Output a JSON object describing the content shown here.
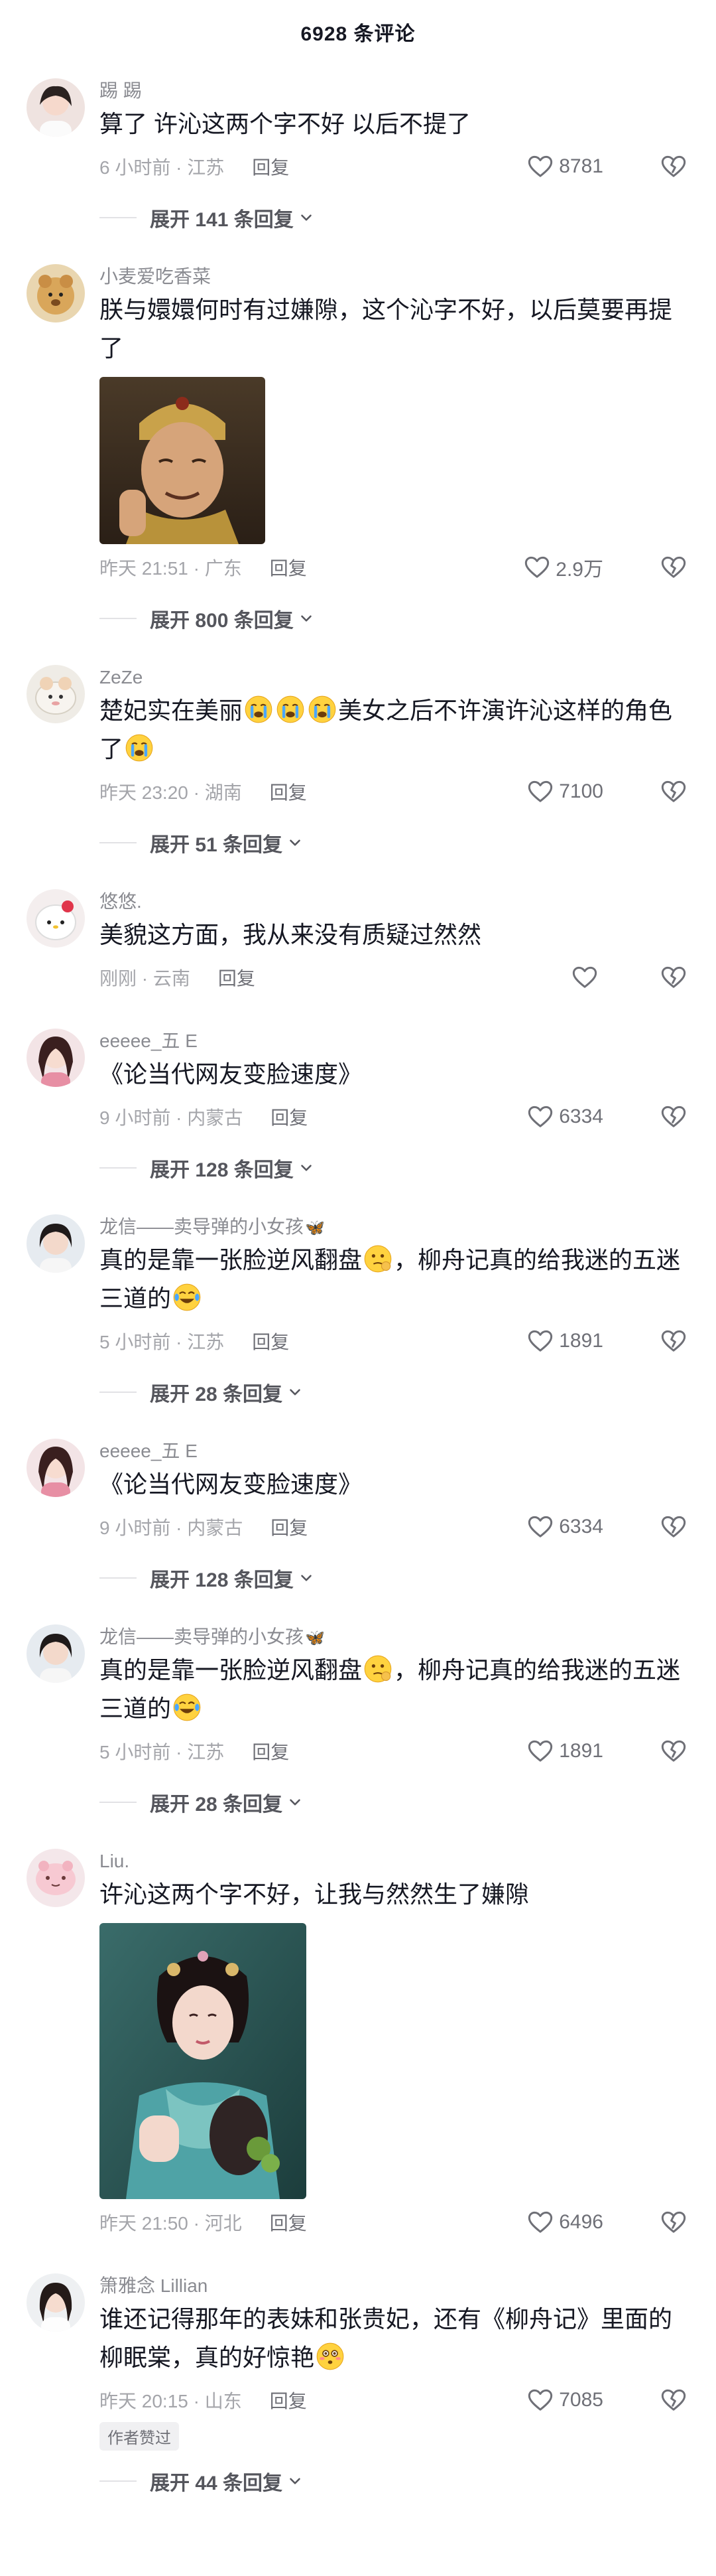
{
  "header": {
    "title": "6928 条评论"
  },
  "colors": {
    "text": "#161823",
    "meta": "#a4a5aa",
    "icon": "#6f7077",
    "accent_green": "#6fc06c"
  },
  "comments": [
    {
      "username": "踢 踢",
      "text": "算了 许沁这两个字不好 以后不提了",
      "time_loc": "6 小时前 · 江苏",
      "reply": "回复",
      "likes": "8781",
      "expand": "展开 141 条回复"
    },
    {
      "username": "小麦爱吃香菜",
      "text": "朕与嬛嬛何时有过嫌隙，这个沁字不好，以后莫要再提了",
      "time_loc": "昨天 21:51 · 广东",
      "reply": "回复",
      "likes": "2.9万",
      "expand": "展开 800 条回复",
      "image_icon": "emperor-portrait"
    },
    {
      "username": "ZeZe",
      "text_a": "楚妃实在美丽",
      "text_b": "美女之后不许演许沁这样的角色了",
      "emoji": "crying-emoji",
      "time_loc": "昨天 23:20 · 湖南",
      "reply": "回复",
      "likes": "7100",
      "expand": "展开 51 条回复"
    },
    {
      "username": "悠悠.",
      "text": "美貌这方面，我从来没有质疑过然然",
      "time_loc": "刚刚 · 云南",
      "reply": "回复",
      "likes": ""
    },
    {
      "username": "eeeee_五 E",
      "text": "《论当代网友变脸速度》",
      "time_loc": "9 小时前 · 内蒙古",
      "reply": "回复",
      "likes": "6334",
      "expand": "展开 128 条回复"
    },
    {
      "username": "龙信——卖导弹的小女孩",
      "text_a": "真的是靠一张脸逆风翻盘",
      "text_b": "，柳舟记真的给我迷的五迷三道的",
      "emoji_a": "thinking-emoji",
      "emoji_b": "laughing-emoji",
      "time_loc": "5 小时前 · 江苏",
      "reply": "回复",
      "likes": "1891",
      "expand": "展开 28 条回复"
    },
    {
      "username": "eeeee_五 E",
      "text": "《论当代网友变脸速度》",
      "time_loc": "9 小时前 · 内蒙古",
      "reply": "回复",
      "likes": "6334",
      "expand": "展开 128 条回复"
    },
    {
      "username": "龙信——卖导弹的小女孩",
      "text_a": "真的是靠一张脸逆风翻盘",
      "text_b": "，柳舟记真的给我迷的五迷三道的",
      "emoji_a": "thinking-emoji",
      "emoji_b": "laughing-emoji",
      "time_loc": "5 小时前 · 江苏",
      "reply": "回复",
      "likes": "1891",
      "expand": "展开 28 条回复"
    },
    {
      "username": "Liu.",
      "text": "许沁这两个字不好，让我与然然生了嫌隙",
      "time_loc": "昨天 21:50 · 河北",
      "reply": "回复",
      "likes": "6496",
      "image_icon": "actress-portrait"
    },
    {
      "username": "箫雅念 Lillian",
      "text": "谁还记得那年的表妹和张贵妃，还有《柳舟记》里面的柳眠棠，真的好惊艳",
      "emoji": "flushed-emoji",
      "time_loc": "昨天 20:15 · 山东",
      "reply": "回复",
      "likes": "7085",
      "author_badge": "作者赞过",
      "expand": "展开 44 条回复"
    }
  ]
}
